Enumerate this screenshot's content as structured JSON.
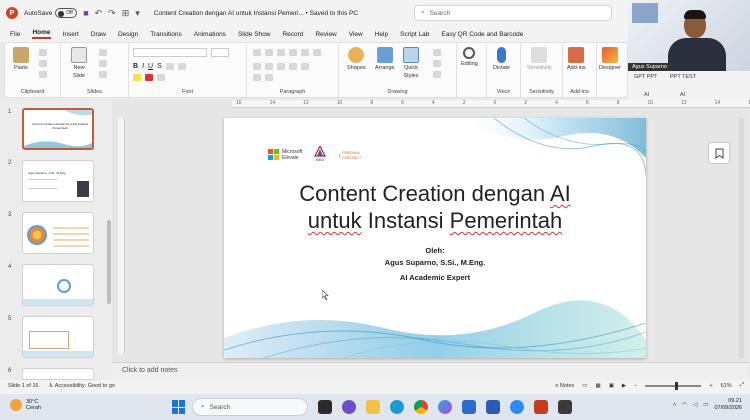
{
  "window": {
    "autosave_label": "AutoSave",
    "autosave_state": "Off",
    "doc_title": "Content Creation dengan AI untuk Instansi Pemeri... • Saved to this PC",
    "search_placeholder": "Search"
  },
  "tabs": [
    "File",
    "Home",
    "Insert",
    "Draw",
    "Design",
    "Transitions",
    "Animations",
    "Slide Show",
    "Record",
    "Review",
    "View",
    "Help",
    "Script Lab",
    "Easy QR Code and Barcode"
  ],
  "ribbon": {
    "paste": "Paste",
    "new_slide_1": "New",
    "new_slide_2": "Slide",
    "shapes": "Shapes",
    "arrange": "Arrange",
    "quick_styles_1": "Quick",
    "quick_styles_2": "Styles",
    "editing": "Editing",
    "dictate": "Dictate",
    "sensitivity": "Sensitivity",
    "addins": "Add-ins",
    "designer": "Designer",
    "groups": {
      "clipboard": "Clipboard",
      "slides": "Slides",
      "font": "Font",
      "paragraph": "Paragraph",
      "drawing": "Drawing",
      "voice": "Voice",
      "sensitivity": "Sensitivity",
      "addins": "Add-ins"
    }
  },
  "webcam": {
    "name": "Agus Suparno",
    "tab1": "GPT PPT",
    "tab2": "PPT TEST",
    "group1": "AI",
    "group2": "AI"
  },
  "thumbnails": [
    "1",
    "2",
    "3",
    "4",
    "5",
    "6"
  ],
  "thumb_texts": {
    "t1": "Content Creation dengan AI untuk Instansi Pemerintah",
    "t2": "Agus Suparno, S.Si., M.Eng."
  },
  "ruler": [
    "16",
    "14",
    "12",
    "10",
    "8",
    "6",
    "4",
    "2",
    "0",
    "2",
    "4",
    "6",
    "8",
    "10",
    "12",
    "14",
    "16"
  ],
  "slide": {
    "logo_ms_1": "Microsoft",
    "logo_ms_2": "Elevate",
    "logo_bkd": "BKD",
    "logo_pc_1": "PREDIKA",
    "logo_pc_2": "CONTACT",
    "title_line1_a": "Content Creation dengan ",
    "title_line1_b": "AI",
    "title_line2_a": "untuk",
    "title_line2_b": " Instansi ",
    "title_line2_c": "Pemerintah",
    "by_label": "Oleh:",
    "author": "Agus Suparno, S.Si., M.Eng.",
    "role": "AI Academic Expert"
  },
  "notes_placeholder": "Click to add notes",
  "status": {
    "slide_count": "Slide 1 of 16",
    "accessibility": "Accessibility: Good to go",
    "notes": "Notes",
    "zoom": "61%"
  },
  "taskbar": {
    "temp": "30°C",
    "weather": "Cerah",
    "search": "Search",
    "time": "09.21",
    "date": "07/09/2026"
  },
  "colors": {
    "accent": "#c43e1c",
    "slide_wave": "#5fb8d8"
  }
}
